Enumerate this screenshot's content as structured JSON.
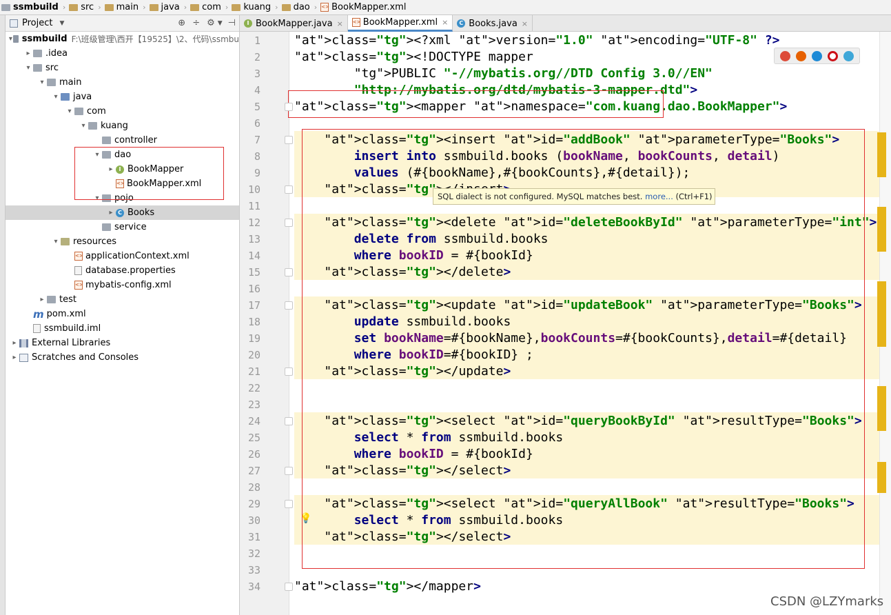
{
  "breadcrumb": [
    "ssmbuild",
    "src",
    "main",
    "java",
    "com",
    "kuang",
    "dao",
    "BookMapper.xml"
  ],
  "project_panel": {
    "title": "Project",
    "settings_icon": "gear-icon"
  },
  "tree": [
    {
      "label": "ssmbuild",
      "path": "F:\\班级管理\\西开【19525】\\2、代码\\ssmbu",
      "depth": 0,
      "arrow": "▾",
      "icon": "module"
    },
    {
      "label": ".idea",
      "depth": 1,
      "arrow": "▸",
      "icon": "folder"
    },
    {
      "label": "src",
      "depth": 1,
      "arrow": "▾",
      "icon": "folder"
    },
    {
      "label": "main",
      "depth": 2,
      "arrow": "▾",
      "icon": "folder"
    },
    {
      "label": "java",
      "depth": 3,
      "arrow": "▾",
      "icon": "src"
    },
    {
      "label": "com",
      "depth": 4,
      "arrow": "▾",
      "icon": "pkg"
    },
    {
      "label": "kuang",
      "depth": 5,
      "arrow": "▾",
      "icon": "pkg"
    },
    {
      "label": "controller",
      "depth": 6,
      "arrow": "",
      "icon": "pkg"
    },
    {
      "label": "dao",
      "depth": 6,
      "arrow": "▾",
      "icon": "pkg"
    },
    {
      "label": "BookMapper",
      "depth": 7,
      "arrow": "▸",
      "icon": "interface"
    },
    {
      "label": "BookMapper.xml",
      "depth": 7,
      "arrow": "",
      "icon": "xml"
    },
    {
      "label": "pojo",
      "depth": 6,
      "arrow": "▾",
      "icon": "pkg"
    },
    {
      "label": "Books",
      "depth": 7,
      "arrow": "▸",
      "icon": "class",
      "selected": true
    },
    {
      "label": "service",
      "depth": 6,
      "arrow": "",
      "icon": "pkg"
    },
    {
      "label": "resources",
      "depth": 3,
      "arrow": "▾",
      "icon": "res"
    },
    {
      "label": "applicationContext.xml",
      "depth": 4,
      "arrow": "",
      "icon": "xml"
    },
    {
      "label": "database.properties",
      "depth": 4,
      "arrow": "",
      "icon": "file"
    },
    {
      "label": "mybatis-config.xml",
      "depth": 4,
      "arrow": "",
      "icon": "xml"
    },
    {
      "label": "test",
      "depth": 2,
      "arrow": "▸",
      "icon": "folder"
    },
    {
      "label": "pom.xml",
      "depth": 1,
      "arrow": "",
      "icon": "maven"
    },
    {
      "label": "ssmbuild.iml",
      "depth": 1,
      "arrow": "",
      "icon": "file"
    },
    {
      "label": "External Libraries",
      "depth": 0,
      "arrow": "▸",
      "icon": "lib"
    },
    {
      "label": "Scratches and Consoles",
      "depth": 0,
      "arrow": "▸",
      "icon": "scratch"
    }
  ],
  "tabs": [
    {
      "label": "BookMapper.java",
      "icon": "I",
      "active": false
    },
    {
      "label": "BookMapper.xml",
      "icon": "xml",
      "active": true
    },
    {
      "label": "Books.java",
      "icon": "C",
      "active": false
    }
  ],
  "code_lines": [
    "<?xml version=\"1.0\" encoding=\"UTF-8\" ?>",
    "<!DOCTYPE mapper",
    "        PUBLIC \"-//mybatis.org//DTD Config 3.0//EN\"",
    "        \"http://mybatis.org/dtd/mybatis-3-mapper.dtd\">",
    "<mapper namespace=\"com.kuang.dao.BookMapper\">",
    "",
    "    <insert id=\"addBook\" parameterType=\"Books\">",
    "        insert into ssmbuild.books (bookName, bookCounts, detail)",
    "        values (#{bookName},#{bookCounts},#{detail});",
    "    </insert>",
    "",
    "    <delete id=\"deleteBookById\" parameterType=\"int\">",
    "        delete from ssmbuild.books",
    "        where bookID = #{bookId}",
    "    </delete>",
    "",
    "    <update id=\"updateBook\" parameterType=\"Books\">",
    "        update ssmbuild.books",
    "        set bookName=#{bookName},bookCounts=#{bookCounts},detail=#{detail}",
    "        where bookID=#{bookID} ;",
    "    </update>",
    "",
    "",
    "    <select id=\"queryBookById\" resultType=\"Books\">",
    "        select * from ssmbuild.books",
    "        where bookID = #{bookId}",
    "    </select>",
    "",
    "    <select id=\"queryAllBook\" resultType=\"Books\">",
    "        select * from ssmbuild.books",
    "    </select>",
    "",
    "",
    "</mapper>"
  ],
  "tooltip": {
    "text": "SQL dialect is not configured. MySQL matches best. ",
    "link": "more...",
    "shortcut": " (Ctrl+F1)"
  },
  "browser_icons": [
    "chrome-icon",
    "firefox-icon",
    "safari-icon",
    "opera-icon",
    "ie-icon"
  ],
  "watermark": "CSDN @LZYmarks",
  "colors": {
    "tag": "#000080",
    "attr": "#0000ff",
    "value": "#008000",
    "field": "#660e7a",
    "highlight": "#fdf5d3",
    "annotation_box": "#e03030"
  }
}
